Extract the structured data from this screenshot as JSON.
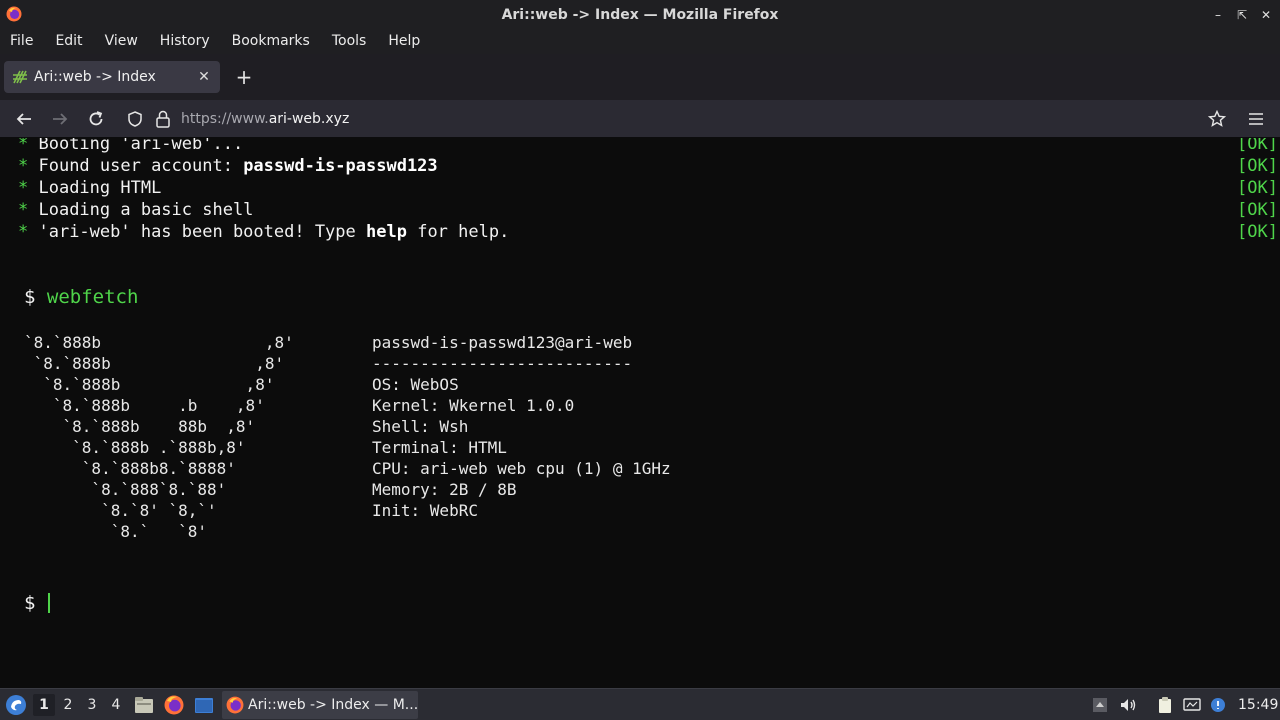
{
  "window": {
    "title": "Ari::web -> Index — Mozilla Firefox"
  },
  "menubar": {
    "items": [
      "File",
      "Edit",
      "View",
      "History",
      "Bookmarks",
      "Tools",
      "Help"
    ]
  },
  "tabs": [
    {
      "title": "Ari::web -> Index",
      "active": true
    }
  ],
  "urlbar": {
    "prefix": "https://www.",
    "domain": "ari-web.xyz"
  },
  "terminal": {
    "boot_lines": [
      {
        "star": "*",
        "pre": " Booting 'ari-web'...",
        "bold": "",
        "post": "",
        "status": "[OK]"
      },
      {
        "star": "*",
        "pre": " Found user account: ",
        "bold": "passwd-is-passwd123",
        "post": "",
        "status": "[OK]"
      },
      {
        "star": "*",
        "pre": " Loading HTML",
        "bold": "",
        "post": "",
        "status": "[OK]"
      },
      {
        "star": "*",
        "pre": " Loading a basic shell",
        "bold": "",
        "post": "",
        "status": "[OK]"
      },
      {
        "star": "*",
        "pre": " 'ari-web' has been booted! Type ",
        "bold": "help",
        "post": " for help.",
        "status": "[OK]"
      }
    ],
    "prompt_symbol": "$",
    "command": "webfetch",
    "ascii_art": [
      "`8.`888b                 ,8'",
      " `8.`888b               ,8'",
      "  `8.`888b             ,8'",
      "   `8.`888b     .b    ,8'",
      "    `8.`888b    88b  ,8'",
      "     `8.`888b .`888b,8'",
      "      `8.`888b8.`8888'",
      "       `8.`888`8.`88'",
      "        `8.`8' `8,`'",
      "         `8.`   `8'"
    ],
    "info_lines": [
      "passwd-is-passwd123@ari-web",
      "---------------------------",
      "OS: WebOS",
      "Kernel: Wkernel 1.0.0",
      "Shell: Wsh",
      "Terminal: HTML",
      "CPU: ari-web web cpu (1) @ 1GHz",
      "Memory: 2B / 8B",
      "Init: WebRC"
    ]
  },
  "taskbar": {
    "workspaces": [
      "1",
      "2",
      "3",
      "4"
    ],
    "task_title": "Ari::web -> Index — M...",
    "clock": "15:49"
  },
  "colors": {
    "terminal_green": "#4fd44a",
    "terminal_bg": "#0c0c0c",
    "chrome_bg": "#1f1f22"
  }
}
